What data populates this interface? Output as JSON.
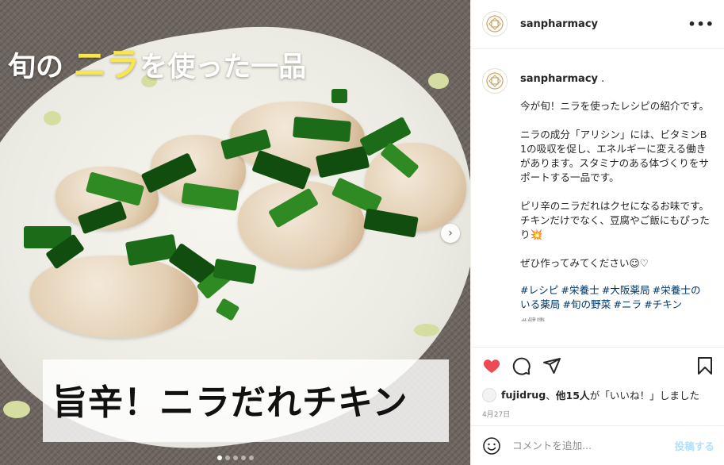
{
  "post": {
    "username": "sanpharmacy",
    "overlay_title_prefix": "旬の",
    "overlay_title_highlight": "ニラ",
    "overlay_title_suffix": "を使った一品",
    "overlay_caption": "旨辛！ニラだれチキン",
    "carousel_total": 5,
    "carousel_current": 1
  },
  "caption": {
    "username": "sanpharmacy",
    "username_suffix": " .",
    "text": "今が旬！ニラを使ったレシピの紹介です。\n\nニラの成分「アリシン」には、ビタミンB1の吸収を促し、エネルギーに変える働きがあります。スタミナのある体づくりをサポートする一品です。\n\nピリ辛のニラだれはクセになるお味です。チキンだけでなく、豆腐やご飯にもぴったり💥\n\nぜひ作ってみてください☺︎♡",
    "hashtags": [
      "#レシピ",
      "#栄養士",
      "#大阪薬局",
      "#栄養士のいる薬局",
      "#旬の野菜",
      "#ニラ",
      "#チキン"
    ],
    "cut_text": "#健康"
  },
  "engagement": {
    "liked_by_user": "fujidrug",
    "liked_by_connector": "、",
    "others_label": "他15人",
    "likes_suffix": "が「いいね！」しました",
    "date": "4月27日"
  },
  "comment_box": {
    "placeholder": "コメントを追加...",
    "post_label": "投稿する"
  },
  "colors": {
    "like_red": "#ed4956",
    "hashtag_blue": "#00376b",
    "post_button_disabled": "#b2dffc",
    "overlay_highlight": "#f8e64b"
  },
  "icons": {
    "more": "more-options-icon",
    "like": "heart-icon",
    "comment": "comment-icon",
    "share": "send-icon",
    "save": "bookmark-icon",
    "emoji": "emoji-icon",
    "next": "chevron-right-icon"
  }
}
